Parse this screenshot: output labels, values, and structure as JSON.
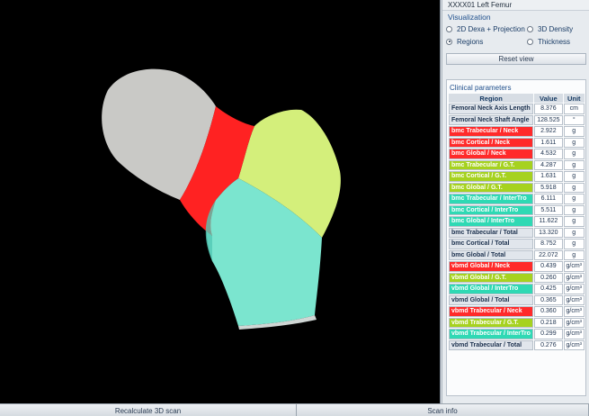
{
  "window": {
    "title": "XXXX01 Left Femur"
  },
  "visualization": {
    "title": "Visualization",
    "options": [
      {
        "label": "2D Dexa + Projection",
        "selected": false
      },
      {
        "label": "3D Density",
        "selected": false
      },
      {
        "label": "Regions",
        "selected": true
      },
      {
        "label": "Thickness",
        "selected": false
      }
    ],
    "reset_label": "Reset view"
  },
  "clinical": {
    "title": "Clinical parameters",
    "columns": [
      "Region",
      "Value",
      "Unit"
    ],
    "rows": [
      {
        "region": "Femoral Neck Axis Length",
        "value": "8.376",
        "unit": "cm",
        "color": "plain"
      },
      {
        "region": "Femoral Neck Shaft Angle",
        "value": "128.525",
        "unit": "°",
        "color": "plain"
      },
      {
        "region": "bmc Trabecular / Neck",
        "value": "2.922",
        "unit": "g",
        "color": "red"
      },
      {
        "region": "bmc Cortical / Neck",
        "value": "1.611",
        "unit": "g",
        "color": "red"
      },
      {
        "region": "bmc Global / Neck",
        "value": "4.532",
        "unit": "g",
        "color": "red"
      },
      {
        "region": "bmc Trabecular / G.T.",
        "value": "4.287",
        "unit": "g",
        "color": "lime"
      },
      {
        "region": "bmc Cortical / G.T.",
        "value": "1.631",
        "unit": "g",
        "color": "lime"
      },
      {
        "region": "bmc Global / G.T.",
        "value": "5.918",
        "unit": "g",
        "color": "lime"
      },
      {
        "region": "bmc Trabecular / InterTro",
        "value": "6.111",
        "unit": "g",
        "color": "teal"
      },
      {
        "region": "bmc Cortical / InterTro",
        "value": "5.511",
        "unit": "g",
        "color": "teal"
      },
      {
        "region": "bmc Global / InterTro",
        "value": "11.622",
        "unit": "g",
        "color": "teal"
      },
      {
        "region": "bmc Trabecular / Total",
        "value": "13.320",
        "unit": "g",
        "color": "plain"
      },
      {
        "region": "bmc Cortical / Total",
        "value": "8.752",
        "unit": "g",
        "color": "plain"
      },
      {
        "region": "bmc Global / Total",
        "value": "22.072",
        "unit": "g",
        "color": "plain"
      },
      {
        "region": "vbmd Global / Neck",
        "value": "0.439",
        "unit": "g/cm³",
        "color": "red"
      },
      {
        "region": "vbmd Global / G.T.",
        "value": "0.260",
        "unit": "g/cm³",
        "color": "lime"
      },
      {
        "region": "vbmd Global / InterTro",
        "value": "0.425",
        "unit": "g/cm³",
        "color": "teal"
      },
      {
        "region": "vbmd Global / Total",
        "value": "0.365",
        "unit": "g/cm³",
        "color": "plain"
      },
      {
        "region": "vbmd Trabecular / Neck",
        "value": "0.360",
        "unit": "g/cm³",
        "color": "red"
      },
      {
        "region": "vbmd Trabecular / G.T.",
        "value": "0.218",
        "unit": "g/cm³",
        "color": "lime"
      },
      {
        "region": "vbmd Trabecular / InterTro",
        "value": "0.299",
        "unit": "g/cm³",
        "color": "teal"
      },
      {
        "region": "vbmd Trabecular / Total",
        "value": "0.276",
        "unit": "g/cm³",
        "color": "plain"
      }
    ]
  },
  "bottom": {
    "recalc_label": "Recalculate 3D scan",
    "scaninfo_label": "Scan info"
  },
  "colors": {
    "neck": "#ff2020",
    "greater_trochanter": "#d6f07c",
    "intertrochanteric": "#7de6d0",
    "head": "#c9c9c7"
  }
}
